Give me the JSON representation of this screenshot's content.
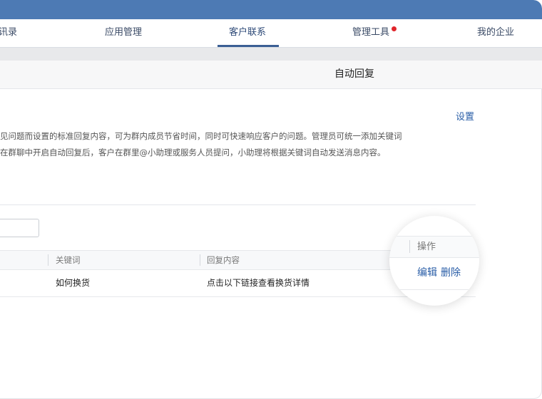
{
  "nav": {
    "items": [
      "讯录",
      "应用管理",
      "客户联系",
      "管理工具",
      "我的企业"
    ]
  },
  "page": {
    "title": "自动回复",
    "settings_link": "设置",
    "description_lines": [
      "见问题而设置的标准回复内容，可为群内成员节省时间，同时可快速响应客户的问题。管理员可统一添加关键词",
      "在群聊中开启自动回复后，客户在群里@小助理或服务人员提问，小助理将根据关键词自动发送消息内容。"
    ]
  },
  "table": {
    "headers": [
      "关键词",
      "回复内容",
      "操作"
    ],
    "rows": [
      {
        "keyword": "如何换货",
        "reply": "点击以下链接查看换货详情",
        "actions": [
          "编辑",
          "删除"
        ]
      }
    ]
  },
  "colors": {
    "titlebar": "#4d7ab4",
    "link": "#2a5ea7",
    "nav_active_underline": "#3b5f94",
    "notification_dot": "#e0252b"
  }
}
